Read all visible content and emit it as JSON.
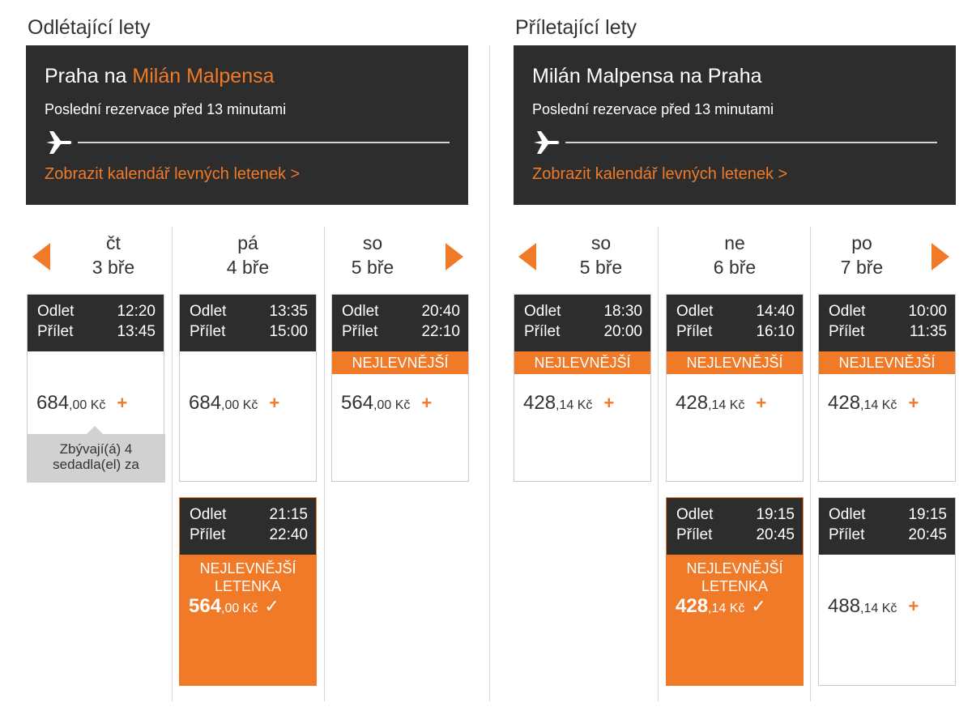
{
  "outbound": {
    "section_title": "Odlétající lety",
    "route_from": "Praha na",
    "route_to": "Milán Malpensa",
    "last_booking": "Poslední rezervace před 13 minutami",
    "calendar_link": "Zobrazit kalendář levných letenek >",
    "days": [
      {
        "dow": "čt",
        "date": "3 bře"
      },
      {
        "dow": "pá",
        "date": "4 bře"
      },
      {
        "dow": "so",
        "date": "5 bře"
      }
    ],
    "flights": {
      "d1f1": {
        "dep_label": "Odlet",
        "dep": "12:20",
        "arr_label": "Přílet",
        "arr": "13:45",
        "price_int": "684",
        "price_dec": ",00 Kč",
        "plus": "+"
      },
      "d2f1": {
        "dep_label": "Odlet",
        "dep": "13:35",
        "arr_label": "Přílet",
        "arr": "15:00",
        "price_int": "684",
        "price_dec": ",00 Kč",
        "plus": "+"
      },
      "d2f2": {
        "dep_label": "Odlet",
        "dep": "21:15",
        "arr_label": "Přílet",
        "arr": "22:40",
        "badge_line1": "NEJLEVNĚJŠÍ",
        "badge_line2": "LETENKA",
        "price_int": "564",
        "price_dec": ",00 Kč",
        "check": "✓"
      },
      "d3f1": {
        "dep_label": "Odlet",
        "dep": "20:40",
        "arr_label": "Přílet",
        "arr": "22:10",
        "badge": "NEJLEVNĚJŠÍ",
        "price_int": "564",
        "price_dec": ",00 Kč",
        "plus": "+"
      }
    },
    "tooltip": "Zbývají(á) 4 sedadla(el) za"
  },
  "inbound": {
    "section_title": "Příletající lety",
    "route_full": "Milán Malpensa na Praha",
    "last_booking": "Poslední rezervace před 13 minutami",
    "calendar_link": "Zobrazit kalendář levných letenek >",
    "days": [
      {
        "dow": "so",
        "date": "5 bře"
      },
      {
        "dow": "ne",
        "date": "6 bře"
      },
      {
        "dow": "po",
        "date": "7 bře"
      }
    ],
    "flights": {
      "d1f1": {
        "dep_label": "Odlet",
        "dep": "18:30",
        "arr_label": "Přílet",
        "arr": "20:00",
        "badge": "NEJLEVNĚJŠÍ",
        "price_int": "428",
        "price_dec": ",14 Kč",
        "plus": "+"
      },
      "d2f1": {
        "dep_label": "Odlet",
        "dep": "14:40",
        "arr_label": "Přílet",
        "arr": "16:10",
        "badge": "NEJLEVNĚJŠÍ",
        "price_int": "428",
        "price_dec": ",14 Kč",
        "plus": "+"
      },
      "d2f2": {
        "dep_label": "Odlet",
        "dep": "19:15",
        "arr_label": "Přílet",
        "arr": "20:45",
        "badge_line1": "NEJLEVNĚJŠÍ",
        "badge_line2": "LETENKA",
        "price_int": "428",
        "price_dec": ",14 Kč",
        "check": "✓"
      },
      "d3f1": {
        "dep_label": "Odlet",
        "dep": "10:00",
        "arr_label": "Přílet",
        "arr": "11:35",
        "badge": "NEJLEVNĚJŠÍ",
        "price_int": "428",
        "price_dec": ",14 Kč",
        "plus": "+"
      },
      "d3f2": {
        "dep_label": "Odlet",
        "dep": "19:15",
        "arr_label": "Přílet",
        "arr": "20:45",
        "price_int": "488",
        "price_dec": ",14 Kč",
        "plus": "+"
      }
    }
  },
  "colors": {
    "accent": "#f07a28",
    "dark": "#2d2d2d",
    "border": "#c8c8c8"
  },
  "icons": {
    "plane": "airplane-icon",
    "prev": "chevron-left-icon",
    "next": "chevron-right-icon",
    "check": "checkmark-icon"
  }
}
